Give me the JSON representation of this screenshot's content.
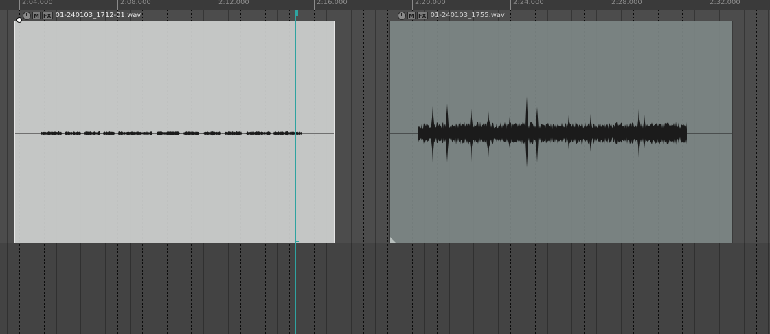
{
  "ruler": {
    "labels": [
      "2:04.000",
      "2:08.000",
      "2:12.000",
      "2:16.000",
      "2:20.000",
      "2:24.000",
      "2:28.000",
      "2:32.000"
    ]
  },
  "items": [
    {
      "name": "01-240103_1712-01.wav",
      "selected": true,
      "buttons": {
        "mute": "M",
        "fx": "FX"
      },
      "peak_level": 0.06
    },
    {
      "name": "01-240103_1755.wav",
      "selected": false,
      "buttons": {
        "mute": "M",
        "fx": "FX"
      },
      "peak_level": 0.35
    }
  ],
  "colors": {
    "background": "#454545",
    "track_area": "#4c4c4c",
    "item_selected": "#cdd0cf",
    "item_unselected": "#7d8785",
    "waveform": "#1b1b1b",
    "edit_cursor": "#2fa3a0"
  },
  "icons": {
    "item_lock": "clock-icon",
    "mute": "mute-button",
    "fx": "fx-button"
  }
}
